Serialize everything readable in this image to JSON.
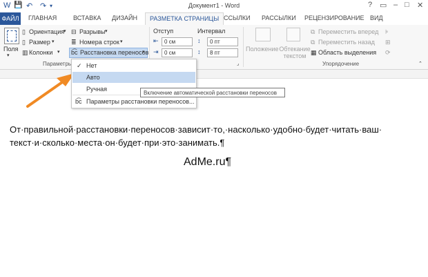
{
  "window": {
    "title": "Документ1 - Word",
    "controls": [
      "?",
      "▭",
      "–",
      "□",
      "✕"
    ]
  },
  "quick_access": [
    "W",
    "💾",
    "↶",
    "↷",
    "▾"
  ],
  "tabs": {
    "file": "ФАЙЛ",
    "items": [
      "ГЛАВНАЯ",
      "ВСТАВКА",
      "ДИЗАЙН",
      "РАЗМЕТКА СТРАНИЦЫ",
      "ССЫЛКИ",
      "РАССЫЛКИ",
      "РЕЦЕНЗИРОВАНИЕ",
      "ВИД"
    ],
    "active": "РАЗМЕТКА СТРАНИЦЫ"
  },
  "ribbon": {
    "page_setup": {
      "fields_label": "Поля",
      "orientation": "Ориентация",
      "size": "Размер",
      "columns": "Колонки",
      "breaks": "Разрывы",
      "line_numbers": "Номера строк",
      "hyphenation": "Расстановка переносов",
      "group_label": "Параметры"
    },
    "paragraph": {
      "indent_label": "Отступ",
      "spacing_label": "Интервал",
      "indent_left": "0 см",
      "indent_right": "0 см",
      "spacing_before": "0 пт",
      "spacing_after": "8 пт"
    },
    "arrange": {
      "position": "Положение",
      "wrap_text": "Обтекание текстом",
      "bring_forward": "Переместить вперед",
      "send_backward": "Переместить назад",
      "selection_pane": "Область выделения",
      "group_label": "Упорядочение"
    }
  },
  "menu": {
    "items": [
      "Нет",
      "Авто",
      "Ручная",
      "Параметры расстановки переносов..."
    ],
    "checked": "Нет",
    "highlighted": "Авто"
  },
  "tooltip": "Включение автоматической расстановки переносов",
  "document": {
    "line1": "От·правильной·расстановки·переносов·зависит·то,·насколько·удобно·будет·читать·ваш·",
    "line2": "текст·и·сколько·места·он·будет·при·это·занимать.¶",
    "line3": "AdMe.ru¶"
  },
  "colors": {
    "accent": "#2b579a",
    "arrow": "#f08a24",
    "menu_highlight": "#c5d9f1"
  }
}
